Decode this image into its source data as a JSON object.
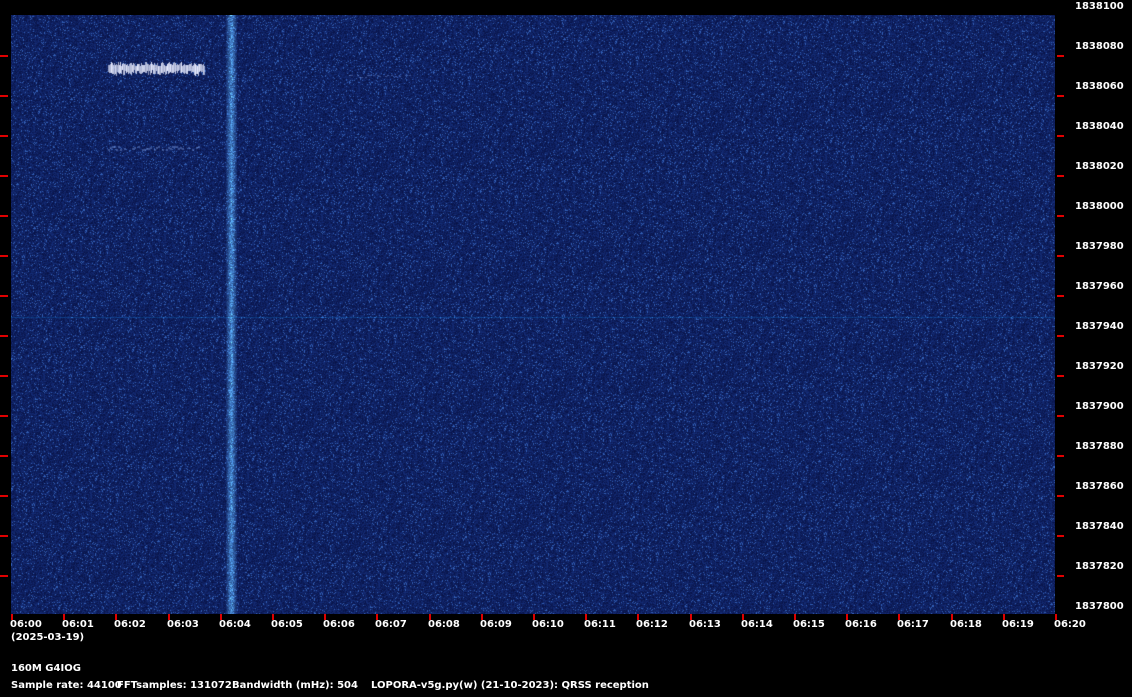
{
  "frequency_axis": {
    "labels": [
      "1838100",
      "1838080",
      "1838060",
      "1838040",
      "1838020",
      "1838000",
      "1837980",
      "1837960",
      "1837940",
      "1837920",
      "1837900",
      "1837880",
      "1837860",
      "1837840",
      "1837820",
      "1837800"
    ]
  },
  "time_axis": {
    "labels": [
      "06:00",
      "06:01",
      "06:02",
      "06:03",
      "06:04",
      "06:05",
      "06:06",
      "06:07",
      "06:08",
      "06:09",
      "06:10",
      "06:11",
      "06:12",
      "06:13",
      "06:14",
      "06:15",
      "06:16",
      "06:17",
      "06:18",
      "06:19",
      "06:20"
    ],
    "date": "(2025-03-19)"
  },
  "footer": {
    "station": "160M G4IOG",
    "sample_rate": "Sample rate: 44100",
    "fft_samples": "FFTsamples: 131072",
    "bandwidth": "Bandwidth (mHz): 504",
    "software": "LOPORA-v5g.py(w) (21-10-2023): QRSS reception"
  },
  "colors": {
    "background": "#000000",
    "waterfall_base": "#0e1a5a",
    "tick": "#e00000",
    "signal": "#e8ecff"
  }
}
